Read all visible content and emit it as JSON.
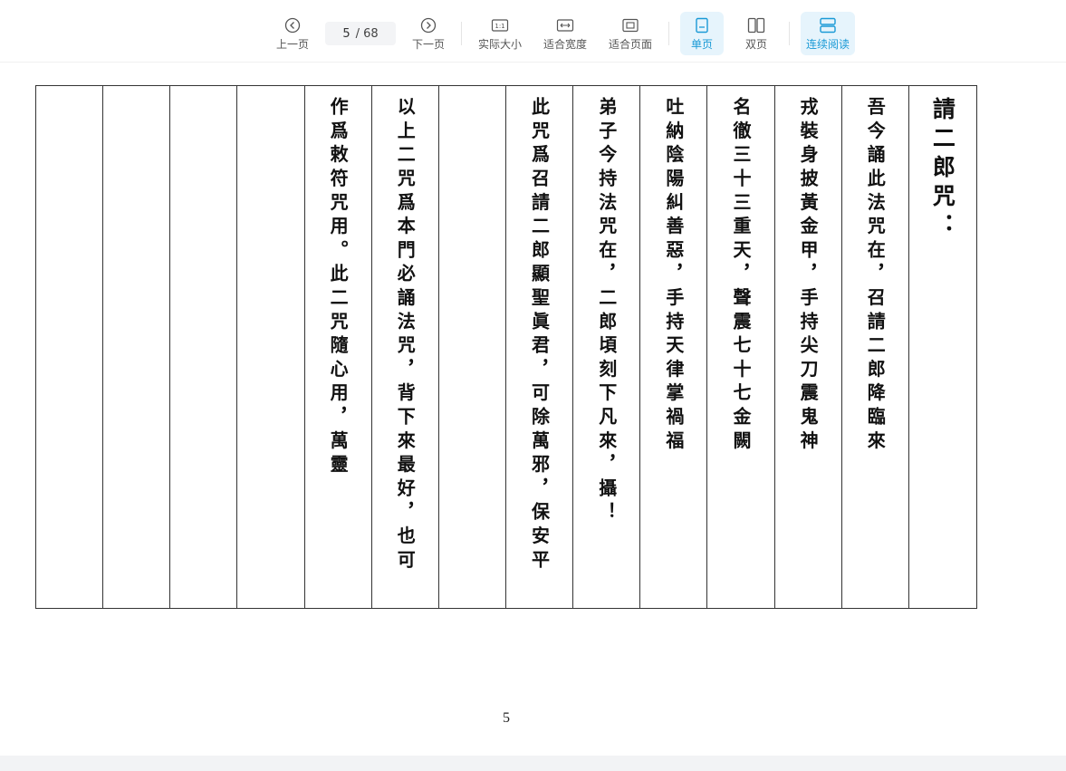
{
  "toolbar": {
    "prev_label": "上一页",
    "next_label": "下一页",
    "current_page": "5",
    "total_pages": "/ 68",
    "actual_size_label": "实际大小",
    "fit_width_label": "适合宽度",
    "fit_page_label": "适合页面",
    "single_page_label": "单页",
    "double_page_label": "双页",
    "continuous_label": "连续阅读",
    "accent_color": "#1a9ad6"
  },
  "document": {
    "columns": [
      "請二郎咒：",
      "吾今誦此法咒在，召請二郎降臨來",
      "戎裝身披黃金甲，手持尖刀震鬼神",
      "名徹三十三重天，聲震七十七金闕",
      "吐納陰陽糾善惡，手持天律掌禍福",
      "弟子今持法咒在，二郎頃刻下凡來，攝！",
      "此咒爲召請二郎顯聖眞君，可除萬邪，保安平",
      "",
      "以上二咒爲本門必誦法咒，背下來最好，也可",
      "作爲敕符咒用。此二咒隨心用，萬靈",
      "",
      "",
      "",
      ""
    ],
    "page_number": "5"
  }
}
